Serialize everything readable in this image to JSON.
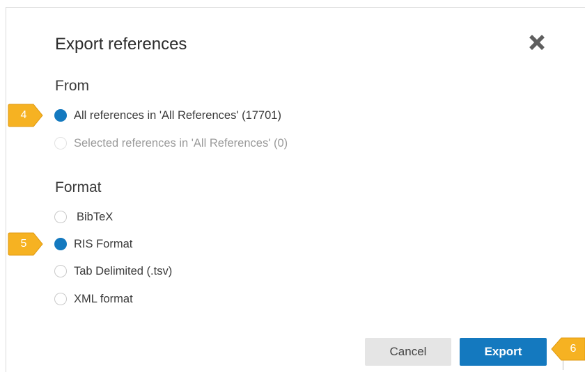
{
  "dialog": {
    "title": "Export references",
    "close_icon": "close-icon"
  },
  "from": {
    "label": "From",
    "options": [
      {
        "label": "All references in 'All References' (17701)",
        "checked": true,
        "disabled": false
      },
      {
        "label": "Selected references in 'All References' (0)",
        "checked": false,
        "disabled": true
      }
    ]
  },
  "format": {
    "label": "Format",
    "options": [
      {
        "label": "BibTeX",
        "checked": false
      },
      {
        "label": "RIS Format",
        "checked": true
      },
      {
        "label": "Tab Delimited (.tsv)",
        "checked": false
      },
      {
        "label": "XML format",
        "checked": false
      }
    ]
  },
  "buttons": {
    "cancel": "Cancel",
    "export": "Export"
  },
  "callouts": {
    "step4": "4",
    "step5": "5",
    "step6": "6"
  },
  "colors": {
    "accent": "#1479bf",
    "callout": "#f6b222"
  }
}
